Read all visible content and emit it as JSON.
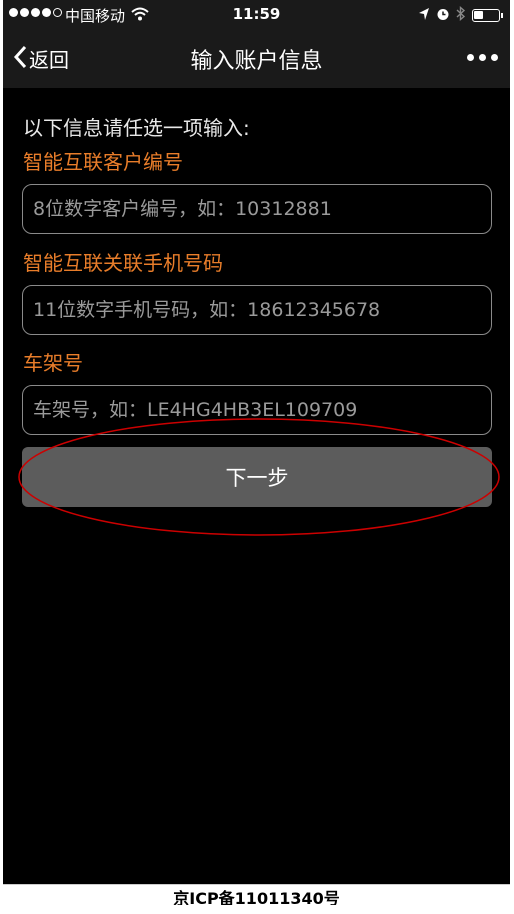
{
  "status_bar": {
    "carrier": "中国移动",
    "time": "11:59"
  },
  "nav": {
    "back_label": "返回",
    "title": "输入账户信息"
  },
  "form": {
    "intro": "以下信息请任选一项输入:",
    "fields": [
      {
        "label": "智能互联客户编号",
        "placeholder": "8位数字客户编号，如：10312881"
      },
      {
        "label": "智能互联关联手机号码",
        "placeholder": "11位数字手机号码，如：18612345678"
      },
      {
        "label": "车架号",
        "placeholder": "车架号，如：LE4HG4HB3EL109709"
      }
    ],
    "next_label": "下一步"
  },
  "footer": {
    "icp": "京ICP备11011340号"
  },
  "colors": {
    "label_orange": "#e87d2a",
    "annotation_red": "#cc0000",
    "button_gray": "#5c5c5c"
  },
  "icons": [
    "wifi-icon",
    "location-arrow-icon",
    "alarm-icon",
    "bluetooth-icon",
    "battery-icon",
    "chevron-left-icon",
    "more-dots-icon"
  ]
}
